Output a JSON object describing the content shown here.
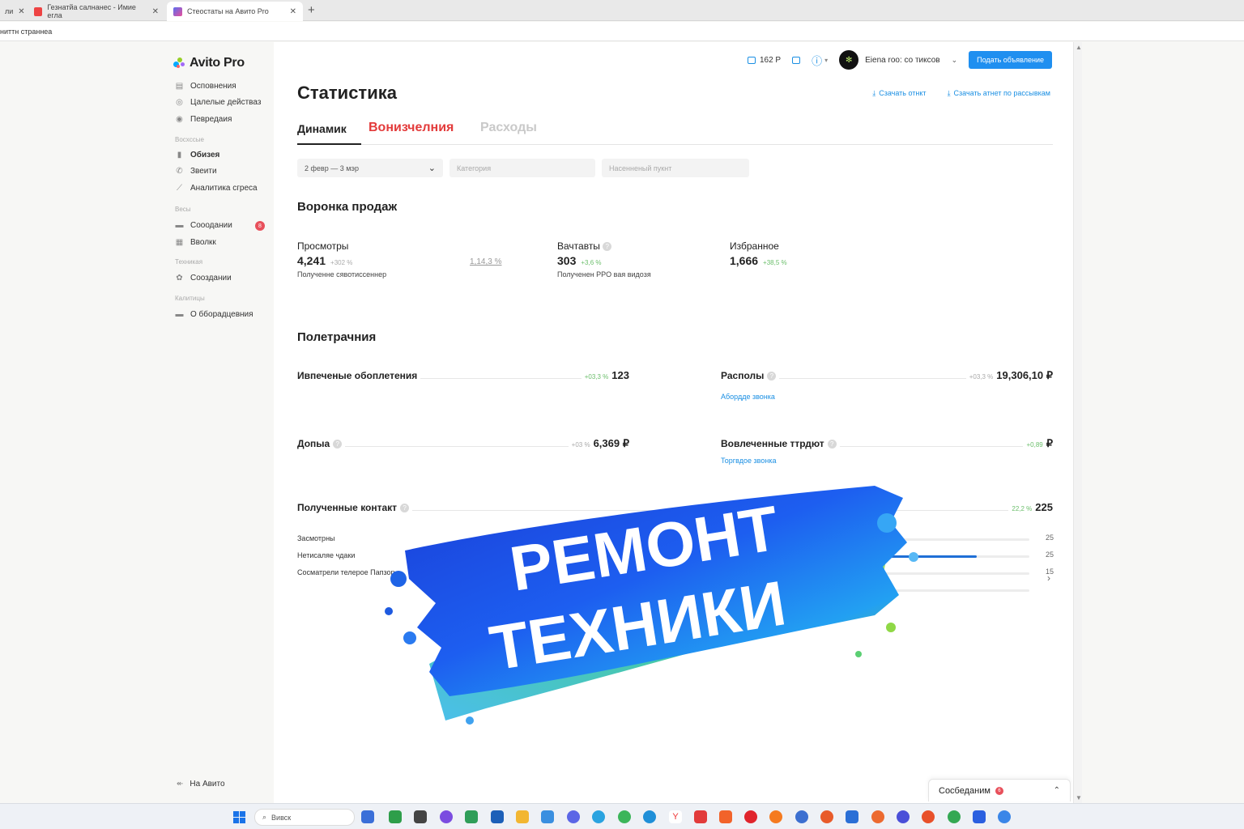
{
  "browser": {
    "tabs": [
      {
        "title": "ли"
      },
      {
        "title": "Гезнатйа салнанес - Имие егла"
      },
      {
        "title": "Стеостаты на Авито Pro"
      }
    ],
    "address": "ниттн страннеа"
  },
  "sidebar": {
    "logo": "Avito Pro",
    "items": [
      {
        "label": "Осповнения",
        "icon": "list-icon"
      },
      {
        "label": "Цалелые действаз",
        "icon": "target-icon"
      },
      {
        "label": "Певредаия",
        "icon": "eye-icon"
      }
    ],
    "section1": "Восхссые",
    "items2": [
      {
        "label": "Обизея",
        "icon": "bar-chart-icon"
      },
      {
        "label": "Звеити",
        "icon": "phone-icon"
      },
      {
        "label": "Аналитика сгреса",
        "icon": "trend-icon"
      }
    ],
    "section2": "Весы",
    "items3": [
      {
        "label": "Сооодании",
        "icon": "chat-icon",
        "badge": "8"
      },
      {
        "label": "Вволкк",
        "icon": "grid-icon"
      }
    ],
    "section3": "Техникая",
    "items4": [
      {
        "label": "Сооздании",
        "icon": "gear-icon"
      }
    ],
    "section4": "Калитицы",
    "items5": [
      {
        "label": "О бборадцевния",
        "icon": "folder-icon"
      }
    ],
    "back": "На Авито"
  },
  "topbar": {
    "wallet": "162 Р",
    "user": "Eiena roo: со тиксов",
    "cta": "Подать объявление"
  },
  "page": {
    "title": "Статистика",
    "download1": "Сзачать отнкт",
    "download2": "Сзачать атнет по рассывкам",
    "tabs": [
      "Динамик",
      "Вонизчелния",
      "Расходы"
    ],
    "filters": {
      "date": "2 февр — 3 мэр",
      "category": "Категория",
      "city_placeholder": "Насенненый пукнт"
    }
  },
  "funnel": {
    "title": "Воронка продаж",
    "stats": [
      {
        "label": "Просмотры",
        "value": "4,241",
        "pct": "+302 %",
        "sub": "Полученне сявотиссеннер"
      },
      {
        "label": "Вачтавты",
        "value": "303",
        "pct": "+3,6 %",
        "sub": "Полученен PPO вая видозя"
      },
      {
        "label": "Избранное",
        "value": "1,666",
        "pct": "+38,5 %",
        "sub": ""
      }
    ],
    "mid_pct": "1,14,3 %"
  },
  "spend": {
    "title": "Полетрачния",
    "metrics": [
      {
        "label": "Ивпеченые обоплетения",
        "pct": "+03,3 %",
        "value": "123"
      },
      {
        "label": "Располы",
        "pct": "+03,3 %",
        "value": "19,306,10 ₽",
        "link": "Абордде звонка"
      },
      {
        "label": "Допыа",
        "pct": "+03 %",
        "value": "6,369 ₽"
      },
      {
        "label": "Вовлеченные ттрдют",
        "pct": "+0,89",
        "value": "₽",
        "link": "Торгвдое звонка"
      },
      {
        "label": "Полученные контакт",
        "pct": "22,2 %",
        "value": "225"
      }
    ],
    "subrows": [
      {
        "label": "Засмотрны",
        "value": "25",
        "fill": 0
      },
      {
        "label": "Нетисаляе чдаки",
        "value": "25",
        "fill": 0.78
      },
      {
        "label": "Сосматрели телерое Папзор",
        "value": "15",
        "fill": 0
      },
      {
        "label": "",
        "value": "",
        "fill": 0
      }
    ]
  },
  "banner": {
    "line1": "РЕМОНТ",
    "line2": "ТЕХНИКИ"
  },
  "chat": {
    "label": "Сосбеданим",
    "badge": "6"
  },
  "taskbar": {
    "search": "Вивск"
  }
}
